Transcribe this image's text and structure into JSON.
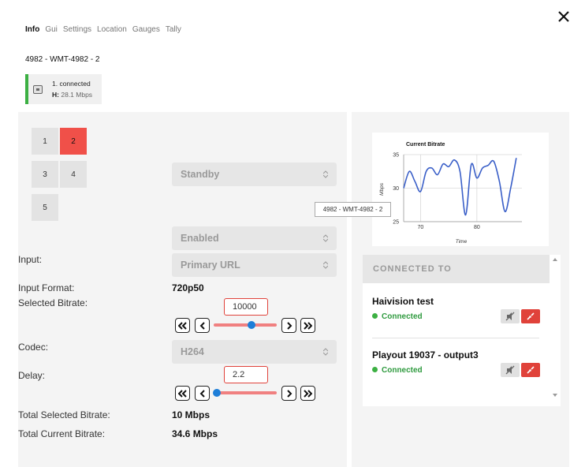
{
  "tabs": [
    "Info",
    "Gui",
    "Settings",
    "Location",
    "Gauges",
    "Tally"
  ],
  "device_title": "4982 - WMT-4982 - 2",
  "connection": {
    "name": "1. connected",
    "h_label": "H:",
    "bitrate": "28.1 Mbps"
  },
  "channels": [
    "1",
    "2",
    "3",
    "4",
    "5"
  ],
  "active_channel": "2",
  "mode_select": "Standby",
  "enabled_select": "Enabled",
  "input": {
    "label": "Input:",
    "value": "Primary URL"
  },
  "input_format": {
    "label": "Input Format:",
    "value": "720p50"
  },
  "selected_bitrate": {
    "label": "Selected Bitrate:",
    "value": "10000",
    "slider_fraction": 0.6
  },
  "codec": {
    "label": "Codec:",
    "value": "H264"
  },
  "delay": {
    "label": "Delay:",
    "value": "2.2",
    "slider_fraction": 0.05
  },
  "total_selected_bitrate": {
    "label": "Total Selected Bitrate:",
    "value": "10 Mbps"
  },
  "total_current_bitrate": {
    "label": "Total Current Bitrate:",
    "value": "34.6 Mbps"
  },
  "tooltip": "4982 - WMT-4982 - 2",
  "connected_to": {
    "header": "CONNECTED TO",
    "outputs": [
      {
        "name": "Haivision test",
        "status": "Connected"
      },
      {
        "name": "Playout 19037 - output3",
        "status": "Connected"
      }
    ]
  },
  "colors": {
    "accent_red": "#f05049",
    "connected_green": "#3cb043",
    "line_blue": "#3a5fc8"
  },
  "chart_data": {
    "type": "line",
    "title": "Current Bitrate",
    "xlabel": "Time",
    "ylabel": "Mbps",
    "xlim": [
      67,
      88
    ],
    "ylim": [
      25,
      35
    ],
    "xticks": [
      "70",
      "80"
    ],
    "yticks": [
      "25",
      "30",
      "35"
    ],
    "grid": true,
    "series": [
      {
        "x": [
          67,
          68,
          69,
          70,
          71,
          72,
          73,
          74,
          75,
          76,
          77,
          78,
          79,
          80,
          81,
          82,
          83,
          84,
          85,
          86,
          87
        ],
        "values": [
          30,
          32.5,
          31,
          29.5,
          32.5,
          33,
          32,
          33.6,
          33.2,
          34.2,
          32.5,
          26,
          33.5,
          31.5,
          33,
          33.4,
          34,
          31,
          26.5,
          30,
          34.5
        ]
      }
    ]
  }
}
